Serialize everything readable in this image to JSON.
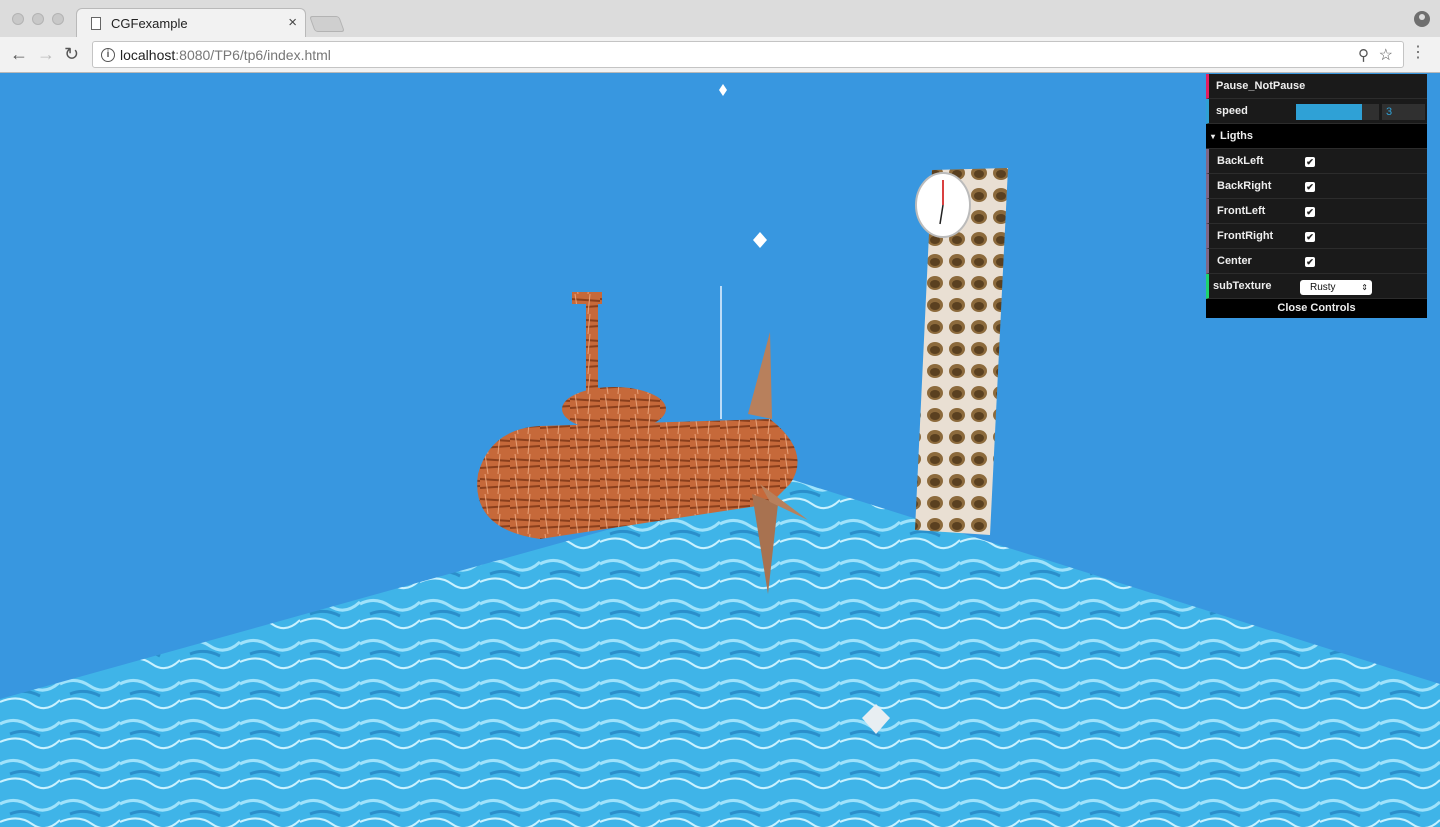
{
  "browser": {
    "tab_title": "CGFexample",
    "tab_close": "×",
    "url_host": "localhost",
    "url_rest": ":8080/TP6/tp6/index.html",
    "back": "←",
    "forward": "→",
    "reload": "↻",
    "info": "i",
    "zoom": "⚲",
    "star": "☆",
    "menu": "⋮"
  },
  "gui": {
    "pause_label": "Pause_NotPause",
    "speed_label": "speed",
    "speed_value": "3",
    "speed_fraction": 0.8,
    "lights_folder": "Ligths",
    "folder_arrow": "▾",
    "lights": [
      {
        "label": "BackLeft",
        "checked": true
      },
      {
        "label": "BackRight",
        "checked": true
      },
      {
        "label": "FrontLeft",
        "checked": true
      },
      {
        "label": "FrontRight",
        "checked": true
      },
      {
        "label": "Center",
        "checked": true
      }
    ],
    "check_glyph": "✔",
    "subtexture_label": "subTexture",
    "subtexture_value": "Rusty",
    "select_arrow": "⇕",
    "close_controls": "Close Controls"
  },
  "scene": {
    "sky_color": "#3897e0",
    "water_color": "#4cc0ee",
    "rust_color": "#c6693a",
    "pillar_color": "#d2c3b3"
  }
}
